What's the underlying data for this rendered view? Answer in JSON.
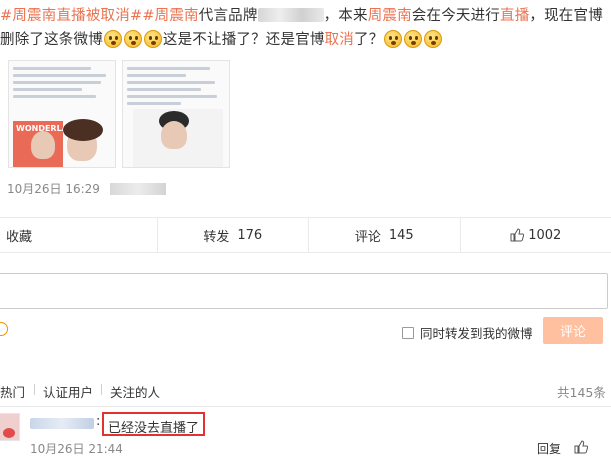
{
  "post": {
    "topic1": "#周震南直播被取消#",
    "topic2": "#周震南",
    "text1": "代言品牌",
    "text2": "，本来",
    "name": "周震南",
    "text3": "会在今天进行",
    "live": "直播",
    "text4": "，现在官博删除了这条微博",
    "text5": "这是不让播了？还是官博",
    "cancel": "取消",
    "text6": "了？",
    "images": {
      "brand_label": "WONDERLAB"
    }
  },
  "meta": {
    "time": "10月26日 16:29"
  },
  "actions": {
    "collect": "收藏",
    "forward_label": "转发",
    "forward_count": "176",
    "comment_label": "评论",
    "comment_count": "145",
    "like_count": "1002"
  },
  "composer": {
    "repost_label": "同时转发到我的微博",
    "submit_label": "评论"
  },
  "filters": {
    "tabs": [
      "热门",
      "认证用户",
      "关注的人"
    ],
    "total": "共145条"
  },
  "comment": {
    "text": "已经没去直播了",
    "time": "10月26日 21:44",
    "reply": "回复"
  },
  "colors": {
    "accent": "#eb7350",
    "submit_disabled": "#ffc09f",
    "highlight_border": "#e0322e"
  },
  "icons": [
    "smile-emoji-icon",
    "thumbs-up-icon",
    "emoji-picker-icon"
  ]
}
